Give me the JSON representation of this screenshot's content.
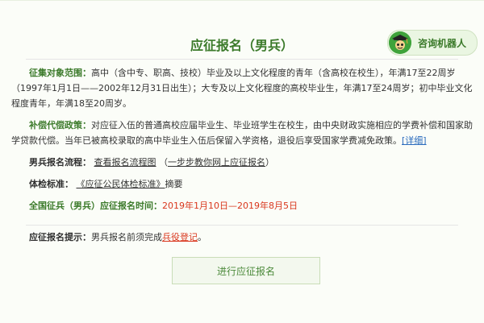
{
  "page": {
    "title": "应征报名（男兵）"
  },
  "robot": {
    "label": "咨询机器人"
  },
  "sections": {
    "target": {
      "label": "征集对象范围：",
      "text": "高中（含中专、职高、技校）毕业及以上文化程度的青年（含高校在校生），年满17至22周岁（1997年1月1日——2002年12月31日出生）；大专及以上文化程度的高校毕业生，年满17至24周岁；初中毕业文化程度青年，年满18至20周岁。"
    },
    "compensation": {
      "label": "补偿代偿政策：",
      "text": "对应征入伍的普通高校应届毕业生、毕业班学生在校生，由中央财政实施相应的学费补偿和国家助学贷款代偿。当年已被高校录取的高中毕业生入伍后保留入学资格，退役后享受国家学费减免政策。",
      "detail_link": "[详细]"
    },
    "process": {
      "label": "男兵报名流程：",
      "link1": "查看报名流程图",
      "link2_prefix": "（",
      "link2": "一步步教你网上应征报名",
      "link2_suffix": "）"
    },
    "standard": {
      "label": "体检标准：",
      "link": "《应征公民体检标准》",
      "suffix": "摘要"
    },
    "time": {
      "label": "全国征兵（男兵）应征报名时间：",
      "value": "2019年1月10日—2019年8月5日"
    }
  },
  "tip": {
    "label": "应征报名提示：",
    "text": "男兵报名前须完成",
    "link": "兵役登记",
    "suffix": "。"
  },
  "button": {
    "label": "进行应征报名"
  }
}
